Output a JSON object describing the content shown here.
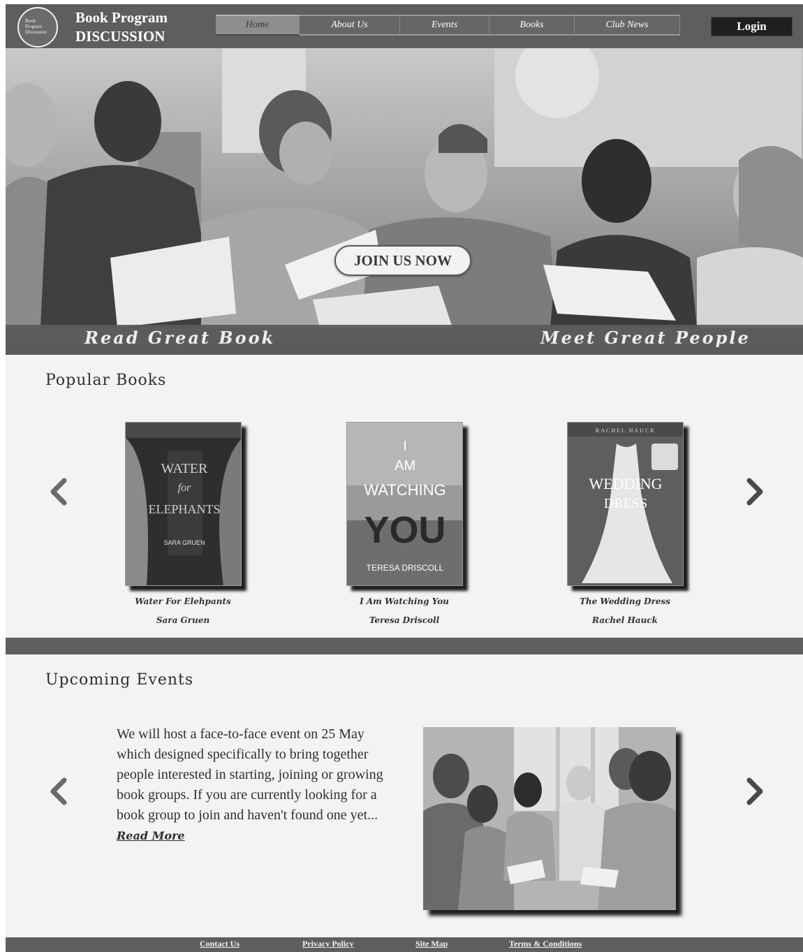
{
  "header": {
    "logo_text": "Book Program Discussion",
    "brand_line1": "Book Program",
    "brand_line2": "DISCUSSION",
    "nav": [
      {
        "label": "Home",
        "active": true
      },
      {
        "label": "About Us",
        "active": false
      },
      {
        "label": "Events",
        "active": false
      },
      {
        "label": "Books",
        "active": false
      },
      {
        "label": "Club News",
        "active": false
      }
    ],
    "login_label": "Login"
  },
  "hero": {
    "cta_label": "JOIN US NOW",
    "tagline_left": "Read Great Book",
    "tagline_right": "Meet Great People"
  },
  "popular_books": {
    "title": "Popular Books",
    "items": [
      {
        "title": "Water For Elehpants",
        "author": "Sara Gruen",
        "cover_line1": "WATER",
        "cover_line2": "for",
        "cover_line3": "ELEPHANTS",
        "cover_author": "SARA GRUEN"
      },
      {
        "title": "I Am Watching You",
        "author": "Teresa Driscoll",
        "cover_line1": "I",
        "cover_line2": "AM",
        "cover_line3": "WATCHING",
        "cover_line4": "YOU",
        "cover_author": "TERESA DRISCOLL"
      },
      {
        "title": "The Wedding Dress",
        "author": "Rachel Hauck",
        "cover_line1": "WEDDING",
        "cover_line2": "DRESS",
        "cover_author": "RACHEL HAUCK"
      }
    ]
  },
  "upcoming_events": {
    "title": "Upcoming Events",
    "description": "We will host a face-to-face event on 25 May which designed specifically to bring together people interested in starting, joining or growing book groups. If you are currently looking for a book group to join and haven't found one yet...",
    "read_more": "Read More"
  },
  "footer": {
    "links": [
      "Contact Us",
      "Privacy Policy",
      "Site Map",
      "Terms & Conditions"
    ]
  },
  "colors": {
    "header_bg": "#5e5e5e",
    "section_bg": "#f3f3f3",
    "login_bg": "#1f1f1f"
  }
}
